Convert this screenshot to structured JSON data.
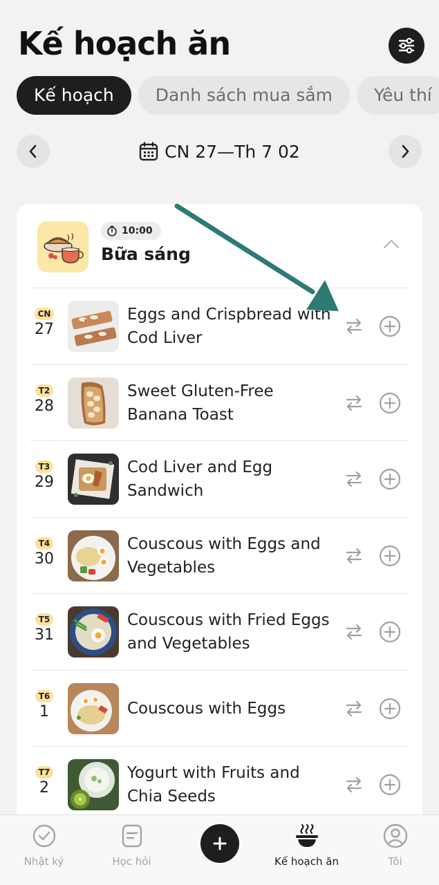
{
  "header": {
    "title": "Kế hoạch ăn",
    "filter_icon": "sliders-icon"
  },
  "tabs": [
    {
      "label": "Kế hoạch",
      "active": true
    },
    {
      "label": "Danh sách mua sắm",
      "active": false
    },
    {
      "label": "Yêu thí",
      "active": false
    }
  ],
  "week": {
    "label": "CN 27—Th 7 02",
    "prev_icon": "chevron-left-icon",
    "next_icon": "chevron-right-icon",
    "calendar_icon": "calendar-icon"
  },
  "meal": {
    "time": "10:00",
    "name": "Bữa sáng",
    "rows": [
      {
        "day": "CN",
        "date": "27",
        "recipe": "Eggs and Crispbread with Cod Liver"
      },
      {
        "day": "T2",
        "date": "28",
        "recipe": "Sweet Gluten-Free Banana Toast"
      },
      {
        "day": "T3",
        "date": "29",
        "recipe": "Cod Liver and Egg Sandwich"
      },
      {
        "day": "T4",
        "date": "30",
        "recipe": "Couscous with Eggs and Vegetables"
      },
      {
        "day": "T5",
        "date": "31",
        "recipe": "Couscous with Fried Eggs and Vegetables"
      },
      {
        "day": "T6",
        "date": "1",
        "recipe": "Couscous with Eggs"
      },
      {
        "day": "T7",
        "date": "2",
        "recipe": "Yogurt with Fruits and Chia Seeds"
      }
    ]
  },
  "bottom_nav": [
    {
      "label": "Nhật ký",
      "icon": "check-circle-icon"
    },
    {
      "label": "Học hỏi",
      "icon": "note-icon"
    },
    {
      "label": "",
      "icon": "plus-icon"
    },
    {
      "label": "Kế hoạch ăn",
      "icon": "bowl-icon",
      "active": true
    },
    {
      "label": "Tôi",
      "icon": "profile-icon"
    }
  ],
  "colors": {
    "accent_dark": "#1e1e1e",
    "badge_yellow": "#fbe29b",
    "annotation_arrow": "#2e7a74",
    "background": "#f2f2f2"
  }
}
